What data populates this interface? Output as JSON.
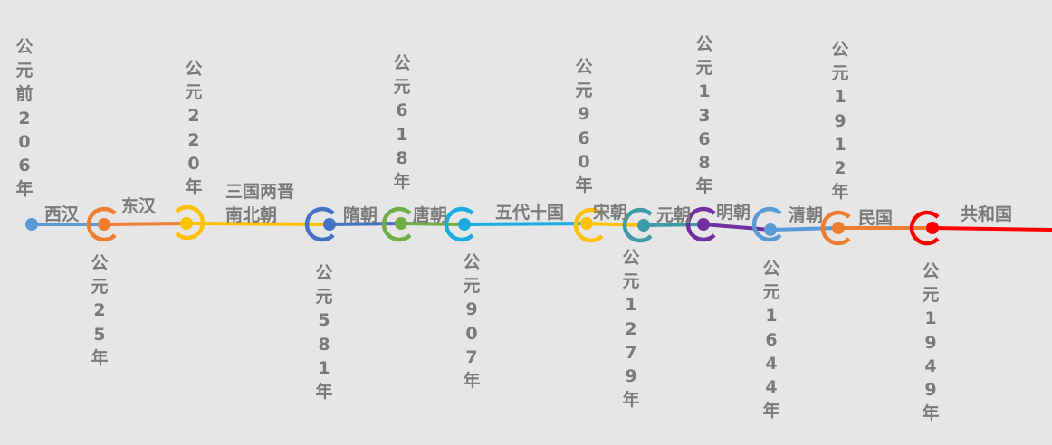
{
  "dynasties": [
    {
      "name": "西汉",
      "color": "#5b9bd5"
    },
    {
      "name": "东汉",
      "color": "#ed7d31"
    },
    {
      "name": "三国两晋南北朝",
      "color": "#ffc000"
    },
    {
      "name": "隋朝",
      "color": "#4472c4"
    },
    {
      "name": "唐朝",
      "color": "#70ad47"
    },
    {
      "name": "五代十国",
      "color": "#1aace1"
    },
    {
      "name": "宋朝",
      "color": "#ffc000"
    },
    {
      "name": "元朝",
      "color": "#3c9ba6"
    },
    {
      "name": "明朝",
      "color": "#7030a0"
    },
    {
      "name": "清朝",
      "color": "#5b9bd5"
    },
    {
      "name": "民国",
      "color": "#ed7d31"
    },
    {
      "name": "共和国",
      "color": "#ff0000"
    }
  ],
  "dates": [
    {
      "text": "公元前206年",
      "position": "above"
    },
    {
      "text": "公元25年",
      "position": "below"
    },
    {
      "text": "公元220年",
      "position": "above"
    },
    {
      "text": "公元581年",
      "position": "below"
    },
    {
      "text": "公元618年",
      "position": "above"
    },
    {
      "text": "公元907年",
      "position": "below"
    },
    {
      "text": "公元960年",
      "position": "above"
    },
    {
      "text": "公元1279年",
      "position": "below"
    },
    {
      "text": "公元1368年",
      "position": "above"
    },
    {
      "text": "公元1644年",
      "position": "below"
    },
    {
      "text": "公元1912年",
      "position": "above"
    },
    {
      "text": "公元1949年",
      "position": "below"
    }
  ]
}
